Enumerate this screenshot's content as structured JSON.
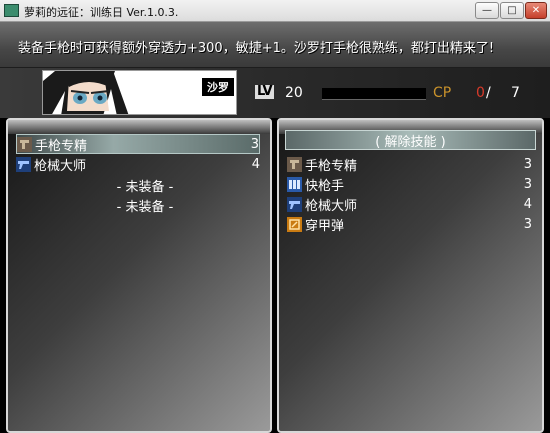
{
  "window": {
    "title": "萝莉的远征：训练日 Ver.1.0.3.",
    "minimize_label": "—",
    "maximize_label": "□",
    "close_label": "✕"
  },
  "help_text": "装备手枪时可获得额外穿透力+300，敏捷+1。沙罗打手枪很熟练，都打出精来了!",
  "character": {
    "name": "沙罗",
    "lv_label": "LV",
    "level": "20",
    "cp_label": "CP",
    "cp_current": "0",
    "cp_separator": "/",
    "cp_max": "7",
    "cp_fill_fraction": 0
  },
  "left_list": {
    "items": [
      {
        "name": "手枪专精",
        "level": "3",
        "icon": "gun-mastery-icon"
      },
      {
        "name": "枪械大师",
        "level": "4",
        "icon": "firearm-master-icon"
      },
      {
        "name": "- 未装备 -",
        "level": "",
        "icon": ""
      },
      {
        "name": "- 未装备 -",
        "level": "",
        "icon": ""
      }
    ]
  },
  "right_list": {
    "header": "( 解除技能 )",
    "items": [
      {
        "name": "手枪专精",
        "level": "3",
        "icon": "gun-mastery-icon"
      },
      {
        "name": "快枪手",
        "level": "3",
        "icon": "quick-draw-icon"
      },
      {
        "name": "枪械大师",
        "level": "4",
        "icon": "firearm-master-icon"
      },
      {
        "name": "穿甲弹",
        "level": "3",
        "icon": "armor-piercing-icon"
      }
    ]
  },
  "colors": {
    "cp_label": "#c9922b",
    "cp_current": "#d83a2a",
    "selection": "#96a9a7"
  }
}
